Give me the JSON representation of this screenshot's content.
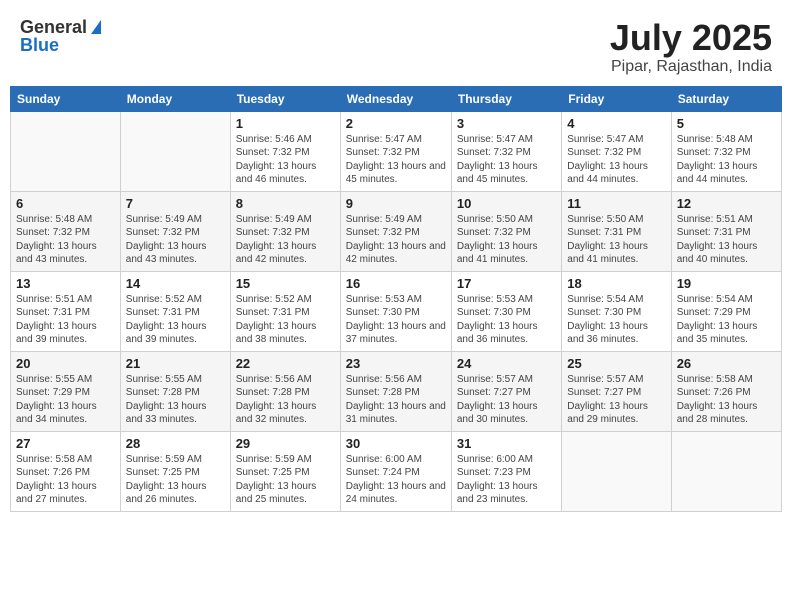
{
  "logo": {
    "general": "General",
    "blue": "Blue"
  },
  "title": {
    "month_year": "July 2025",
    "location": "Pipar, Rajasthan, India"
  },
  "headers": [
    "Sunday",
    "Monday",
    "Tuesday",
    "Wednesday",
    "Thursday",
    "Friday",
    "Saturday"
  ],
  "weeks": [
    [
      {
        "day": "",
        "sunrise": "",
        "sunset": "",
        "daylight": ""
      },
      {
        "day": "",
        "sunrise": "",
        "sunset": "",
        "daylight": ""
      },
      {
        "day": "1",
        "sunrise": "Sunrise: 5:46 AM",
        "sunset": "Sunset: 7:32 PM",
        "daylight": "Daylight: 13 hours and 46 minutes."
      },
      {
        "day": "2",
        "sunrise": "Sunrise: 5:47 AM",
        "sunset": "Sunset: 7:32 PM",
        "daylight": "Daylight: 13 hours and 45 minutes."
      },
      {
        "day": "3",
        "sunrise": "Sunrise: 5:47 AM",
        "sunset": "Sunset: 7:32 PM",
        "daylight": "Daylight: 13 hours and 45 minutes."
      },
      {
        "day": "4",
        "sunrise": "Sunrise: 5:47 AM",
        "sunset": "Sunset: 7:32 PM",
        "daylight": "Daylight: 13 hours and 44 minutes."
      },
      {
        "day": "5",
        "sunrise": "Sunrise: 5:48 AM",
        "sunset": "Sunset: 7:32 PM",
        "daylight": "Daylight: 13 hours and 44 minutes."
      }
    ],
    [
      {
        "day": "6",
        "sunrise": "Sunrise: 5:48 AM",
        "sunset": "Sunset: 7:32 PM",
        "daylight": "Daylight: 13 hours and 43 minutes."
      },
      {
        "day": "7",
        "sunrise": "Sunrise: 5:49 AM",
        "sunset": "Sunset: 7:32 PM",
        "daylight": "Daylight: 13 hours and 43 minutes."
      },
      {
        "day": "8",
        "sunrise": "Sunrise: 5:49 AM",
        "sunset": "Sunset: 7:32 PM",
        "daylight": "Daylight: 13 hours and 42 minutes."
      },
      {
        "day": "9",
        "sunrise": "Sunrise: 5:49 AM",
        "sunset": "Sunset: 7:32 PM",
        "daylight": "Daylight: 13 hours and 42 minutes."
      },
      {
        "day": "10",
        "sunrise": "Sunrise: 5:50 AM",
        "sunset": "Sunset: 7:32 PM",
        "daylight": "Daylight: 13 hours and 41 minutes."
      },
      {
        "day": "11",
        "sunrise": "Sunrise: 5:50 AM",
        "sunset": "Sunset: 7:31 PM",
        "daylight": "Daylight: 13 hours and 41 minutes."
      },
      {
        "day": "12",
        "sunrise": "Sunrise: 5:51 AM",
        "sunset": "Sunset: 7:31 PM",
        "daylight": "Daylight: 13 hours and 40 minutes."
      }
    ],
    [
      {
        "day": "13",
        "sunrise": "Sunrise: 5:51 AM",
        "sunset": "Sunset: 7:31 PM",
        "daylight": "Daylight: 13 hours and 39 minutes."
      },
      {
        "day": "14",
        "sunrise": "Sunrise: 5:52 AM",
        "sunset": "Sunset: 7:31 PM",
        "daylight": "Daylight: 13 hours and 39 minutes."
      },
      {
        "day": "15",
        "sunrise": "Sunrise: 5:52 AM",
        "sunset": "Sunset: 7:31 PM",
        "daylight": "Daylight: 13 hours and 38 minutes."
      },
      {
        "day": "16",
        "sunrise": "Sunrise: 5:53 AM",
        "sunset": "Sunset: 7:30 PM",
        "daylight": "Daylight: 13 hours and 37 minutes."
      },
      {
        "day": "17",
        "sunrise": "Sunrise: 5:53 AM",
        "sunset": "Sunset: 7:30 PM",
        "daylight": "Daylight: 13 hours and 36 minutes."
      },
      {
        "day": "18",
        "sunrise": "Sunrise: 5:54 AM",
        "sunset": "Sunset: 7:30 PM",
        "daylight": "Daylight: 13 hours and 36 minutes."
      },
      {
        "day": "19",
        "sunrise": "Sunrise: 5:54 AM",
        "sunset": "Sunset: 7:29 PM",
        "daylight": "Daylight: 13 hours and 35 minutes."
      }
    ],
    [
      {
        "day": "20",
        "sunrise": "Sunrise: 5:55 AM",
        "sunset": "Sunset: 7:29 PM",
        "daylight": "Daylight: 13 hours and 34 minutes."
      },
      {
        "day": "21",
        "sunrise": "Sunrise: 5:55 AM",
        "sunset": "Sunset: 7:28 PM",
        "daylight": "Daylight: 13 hours and 33 minutes."
      },
      {
        "day": "22",
        "sunrise": "Sunrise: 5:56 AM",
        "sunset": "Sunset: 7:28 PM",
        "daylight": "Daylight: 13 hours and 32 minutes."
      },
      {
        "day": "23",
        "sunrise": "Sunrise: 5:56 AM",
        "sunset": "Sunset: 7:28 PM",
        "daylight": "Daylight: 13 hours and 31 minutes."
      },
      {
        "day": "24",
        "sunrise": "Sunrise: 5:57 AM",
        "sunset": "Sunset: 7:27 PM",
        "daylight": "Daylight: 13 hours and 30 minutes."
      },
      {
        "day": "25",
        "sunrise": "Sunrise: 5:57 AM",
        "sunset": "Sunset: 7:27 PM",
        "daylight": "Daylight: 13 hours and 29 minutes."
      },
      {
        "day": "26",
        "sunrise": "Sunrise: 5:58 AM",
        "sunset": "Sunset: 7:26 PM",
        "daylight": "Daylight: 13 hours and 28 minutes."
      }
    ],
    [
      {
        "day": "27",
        "sunrise": "Sunrise: 5:58 AM",
        "sunset": "Sunset: 7:26 PM",
        "daylight": "Daylight: 13 hours and 27 minutes."
      },
      {
        "day": "28",
        "sunrise": "Sunrise: 5:59 AM",
        "sunset": "Sunset: 7:25 PM",
        "daylight": "Daylight: 13 hours and 26 minutes."
      },
      {
        "day": "29",
        "sunrise": "Sunrise: 5:59 AM",
        "sunset": "Sunset: 7:25 PM",
        "daylight": "Daylight: 13 hours and 25 minutes."
      },
      {
        "day": "30",
        "sunrise": "Sunrise: 6:00 AM",
        "sunset": "Sunset: 7:24 PM",
        "daylight": "Daylight: 13 hours and 24 minutes."
      },
      {
        "day": "31",
        "sunrise": "Sunrise: 6:00 AM",
        "sunset": "Sunset: 7:23 PM",
        "daylight": "Daylight: 13 hours and 23 minutes."
      },
      {
        "day": "",
        "sunrise": "",
        "sunset": "",
        "daylight": ""
      },
      {
        "day": "",
        "sunrise": "",
        "sunset": "",
        "daylight": ""
      }
    ]
  ]
}
